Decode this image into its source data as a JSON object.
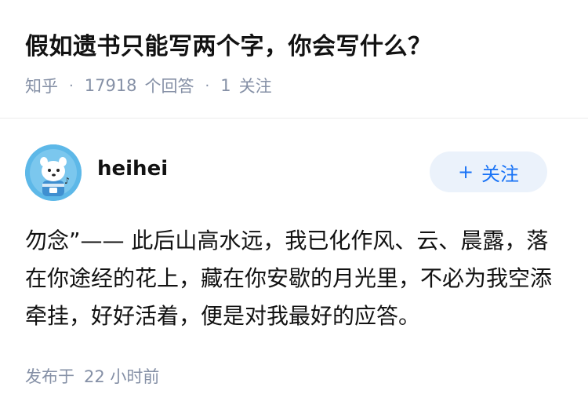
{
  "question": {
    "title": "假如遗书只能写两个字，你会写什么？",
    "source": "知乎",
    "answer_count": "17918",
    "answer_label": "个回答",
    "follower_count": "1",
    "follower_label": "关注"
  },
  "answer": {
    "author": {
      "name": "heihei",
      "follow_button": "关注",
      "avatar_icon": "cartoon-avatar"
    },
    "content": "勿念”—— 此后山高水远，我已化作风、云、晨露，落在你途经的花上，藏在你安歇的月光里，不必为我空添牵挂，好好活着，便是对我最好的应答。",
    "published_label": "发布于",
    "published_time": "22 小时前"
  },
  "colors": {
    "accent": "#1772f6",
    "follow_bg": "#ebf2fb",
    "meta_text": "#8590a6",
    "avatar_bg": "#5db8e8"
  }
}
